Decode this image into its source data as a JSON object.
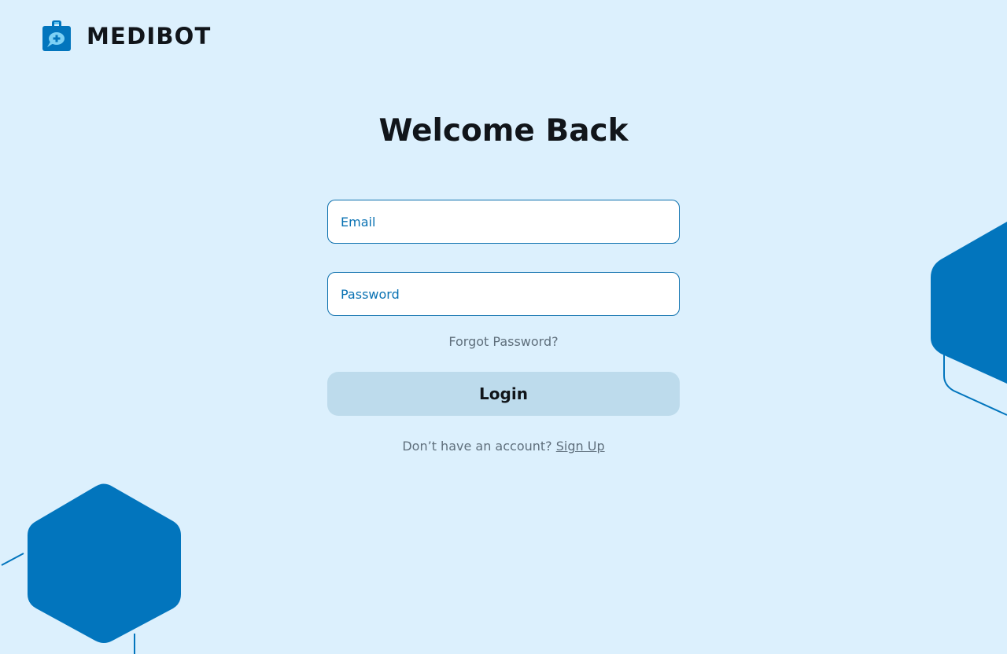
{
  "brand": {
    "name": "MEDIBOT",
    "logo_icon": "medical-case-chat-icon"
  },
  "page": {
    "title": "Welcome Back"
  },
  "form": {
    "email_placeholder": "Email",
    "password_placeholder": "Password",
    "forgot_password": "Forgot Password?",
    "login_label": "Login",
    "signup_prompt": "Don’t have an account?",
    "signup_link": "Sign Up"
  },
  "colors": {
    "background": "#dcf0fd",
    "accent": "#0275bd",
    "button": "#bddbec",
    "text": "#11151a",
    "muted_text": "#5f6f7c"
  }
}
